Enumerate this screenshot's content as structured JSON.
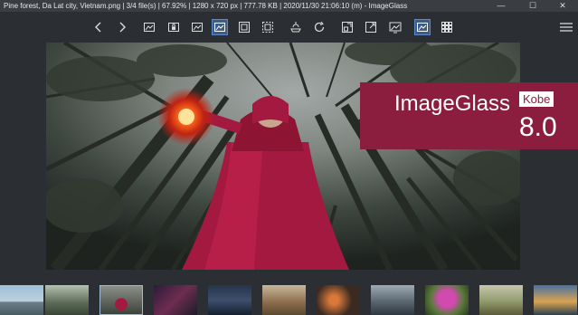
{
  "window": {
    "title": "Pine forest, Da Lat city, Vietnam.png  |  3/4 file(s)  |  67.92%  |  1280 x 720 px  |  777.78 KB  |  2020/11/30 21:06:10 (m)  - ImageGlass",
    "minimize": "—",
    "maximize": "☐",
    "close": "✕"
  },
  "banner": {
    "name": "ImageGlass",
    "edition": "Kobe",
    "version": "8.0"
  },
  "colors": {
    "accent": "#8b1d3e",
    "active_button": "#3d5d86",
    "background": "#2b2e33"
  },
  "toolbar": {
    "icons": [
      "back-icon",
      "forward-icon",
      "actual-size-icon",
      "lock-zoom-icon",
      "zoom-fit-icon",
      "scale-width-icon",
      "scale-height-icon",
      "auto-zoom-icon",
      "rotate-left-icon",
      "rotate-right-icon",
      "flip-icon",
      "fullscreen-icon",
      "slideshow-icon",
      "thumbnail-bar-icon",
      "gallery-grid-icon",
      "menu-icon"
    ]
  },
  "thumbnails": [
    "harbor",
    "forest-girl",
    "pine-forest",
    "sunset",
    "mountain",
    "cows",
    "seagulls",
    "bridge",
    "flowers",
    "landscape",
    "coast"
  ]
}
